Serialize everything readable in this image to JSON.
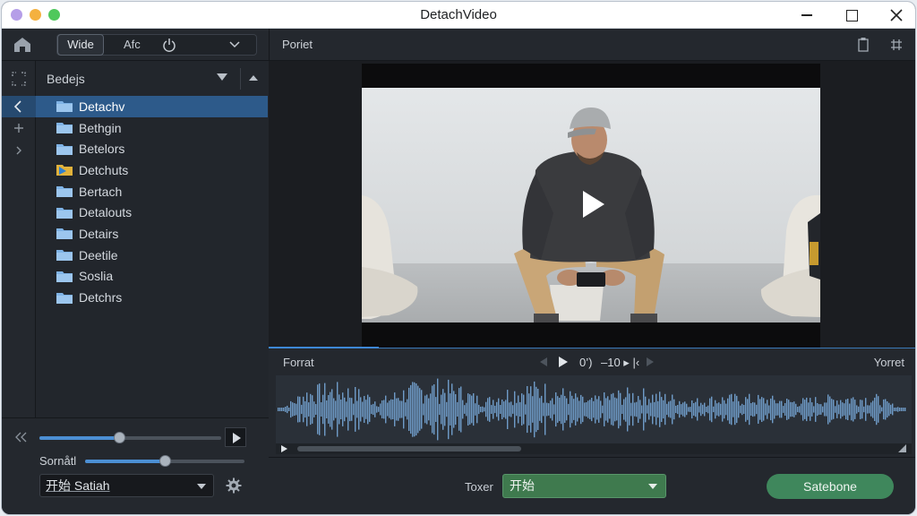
{
  "window": {
    "title": "DetachVideo"
  },
  "toolbar": {
    "wide_label": "Wide",
    "afc_label": "Afc",
    "icons": [
      "home-icon",
      "power-icon",
      "chevron-down-icon"
    ]
  },
  "sidebar": {
    "header_title": "Bedejs",
    "items": [
      {
        "label": "Detachv",
        "selected": true,
        "icon": "folder-icon"
      },
      {
        "label": "Bethgin",
        "selected": false,
        "icon": "folder-icon"
      },
      {
        "label": "Betelors",
        "selected": false,
        "icon": "folder-icon"
      },
      {
        "label": "Detchuts",
        "selected": false,
        "icon": "media-folder-icon"
      },
      {
        "label": "Bertach",
        "selected": false,
        "icon": "folder-icon"
      },
      {
        "label": "Detalouts",
        "selected": false,
        "icon": "folder-icon"
      },
      {
        "label": "Detairs",
        "selected": false,
        "icon": "folder-icon"
      },
      {
        "label": "Deetile",
        "selected": false,
        "icon": "folder-icon"
      },
      {
        "label": "Soslia",
        "selected": false,
        "icon": "folder-icon"
      },
      {
        "label": "Detchrs",
        "selected": false,
        "icon": "folder-icon"
      }
    ]
  },
  "left_panel": {
    "slider1_level": 0.44,
    "slider2_level": 0.5,
    "format_label": "Sornåtl",
    "select_value": "开始 Satiah"
  },
  "preview": {
    "header_label": "Poriet"
  },
  "timeline": {
    "left_label": "Forrat",
    "right_label": "Yorret",
    "timecode": "0’)",
    "step_label": "–10 ▸ |‹",
    "played_fraction": 0.17
  },
  "bottom": {
    "label": "Toxer",
    "select_value": "开始",
    "action_button": "Satebone"
  },
  "colors": {
    "accent_blue": "#2d5a8a",
    "action_green": "#3f875c",
    "waveform": "#6f9cc8"
  }
}
